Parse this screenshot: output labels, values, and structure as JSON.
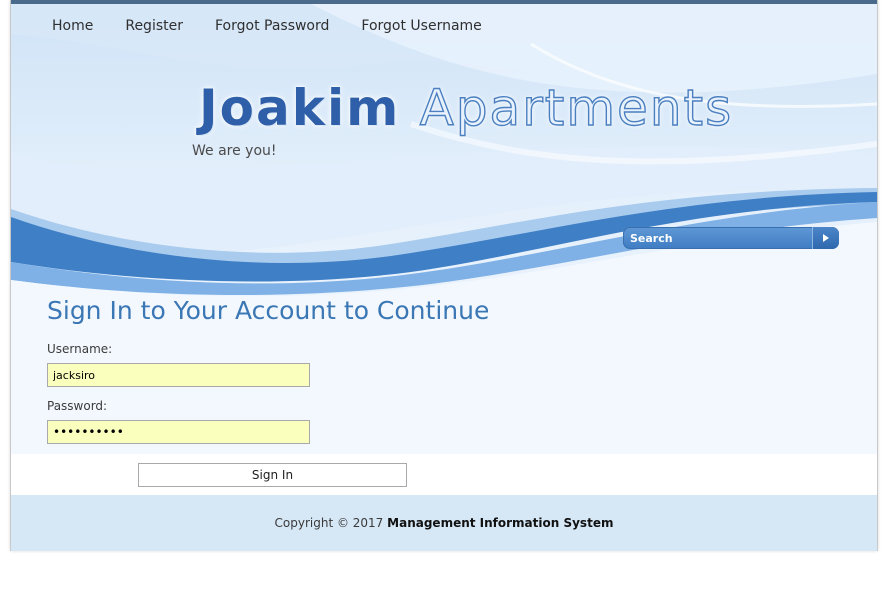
{
  "nav": {
    "items": [
      {
        "label": "Home"
      },
      {
        "label": "Register"
      },
      {
        "label": "Forgot Password"
      },
      {
        "label": "Forgot Username"
      }
    ]
  },
  "header": {
    "title_part1": "Joakim",
    "title_part2": "Apartments",
    "tagline": "We are you!"
  },
  "search": {
    "placeholder": "Search",
    "button_icon": "play-arrow-icon"
  },
  "login": {
    "heading": "Sign In to Your Account to Continue",
    "username_label": "Username:",
    "username_value": "jacksiro",
    "password_label": "Password:",
    "password_value": "••••••••••",
    "submit_label": "Sign In"
  },
  "footer": {
    "copyright": "Copyright © 2017",
    "org": "Management Information System"
  },
  "colors": {
    "accent": "#3a77b4",
    "wave": "#3f7fc6",
    "input_bg": "#fbffbd",
    "footer_bg": "#d6e7f6"
  }
}
